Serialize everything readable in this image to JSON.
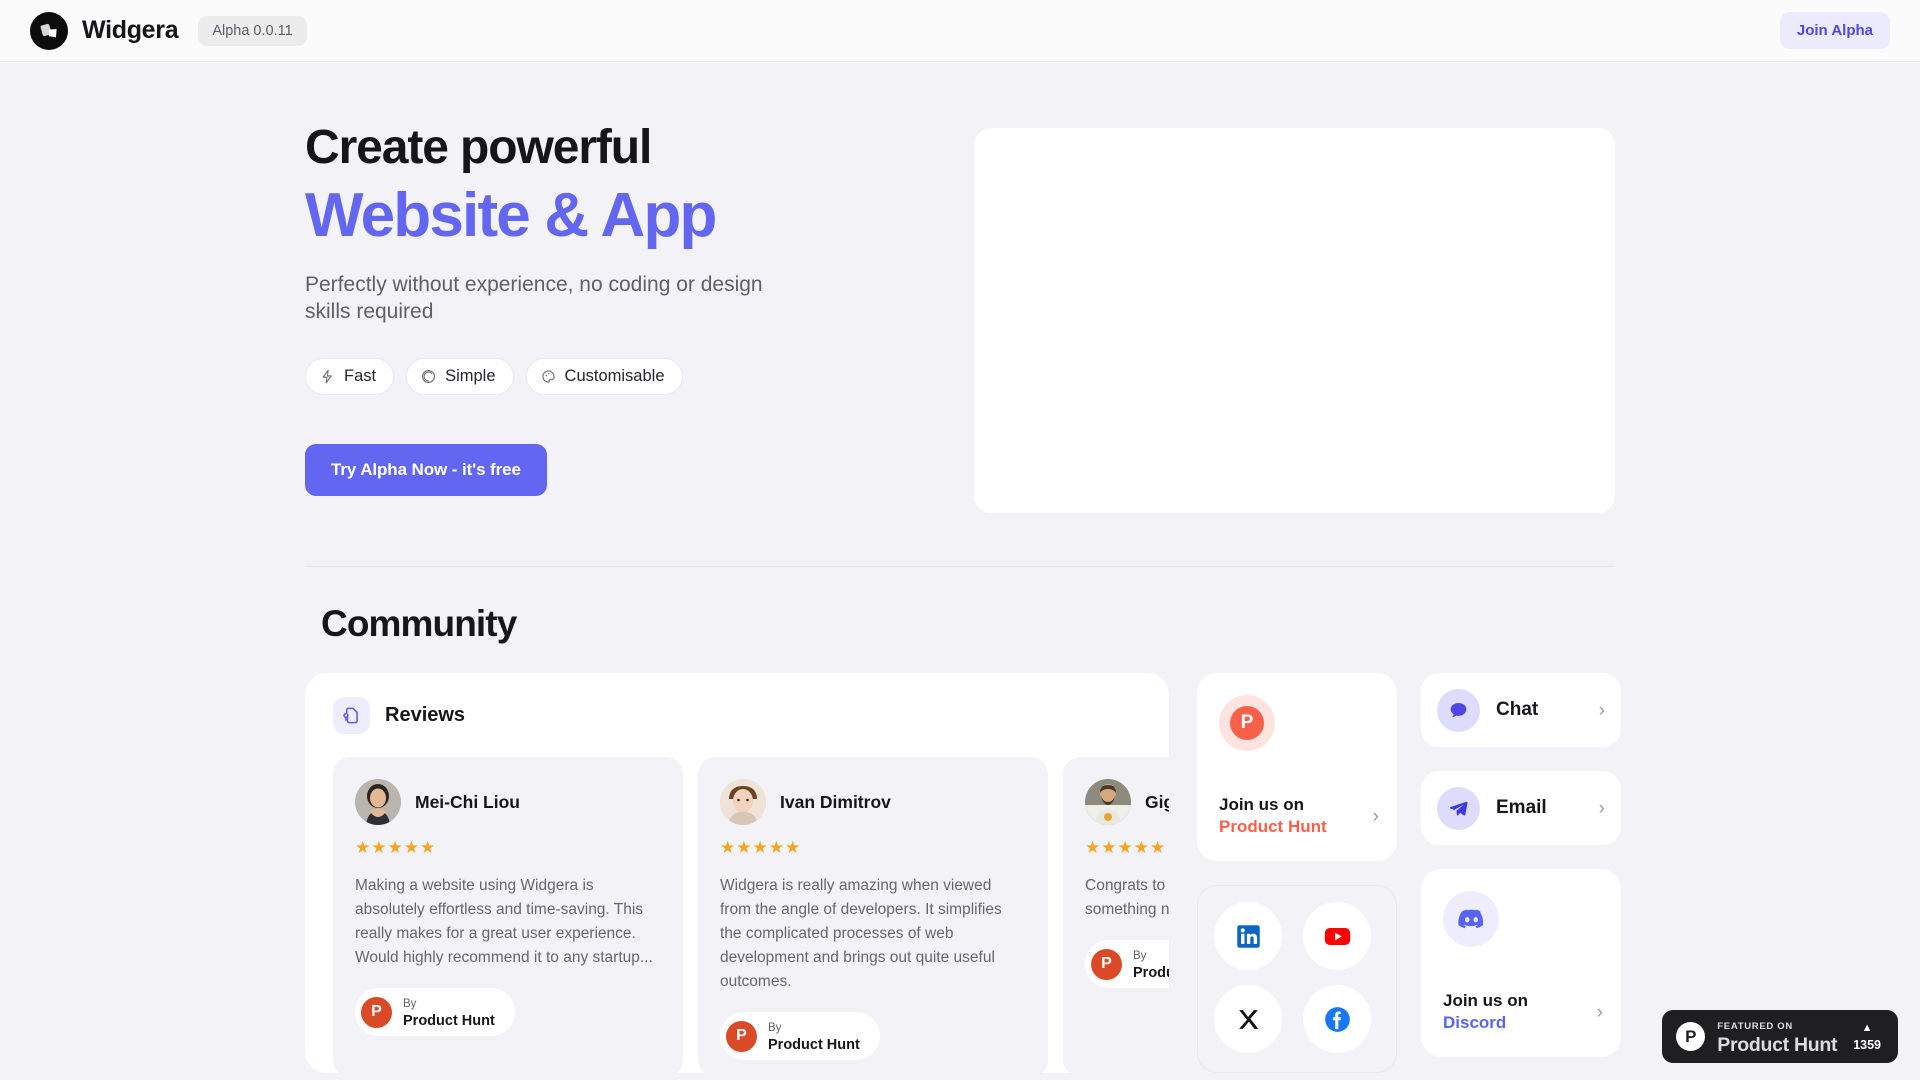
{
  "header": {
    "brand_name": "Widgera",
    "version_label": "Alpha 0.0.11",
    "join_alpha_label": "Join Alpha",
    "logo_icon": "widgera-logo-icon",
    "accent_color": "#6366f1"
  },
  "hero": {
    "title_line1": "Create powerful",
    "title_line2": "Website & App",
    "subtitle": "Perfectly without experience, no coding or design skills required",
    "pills": [
      {
        "label": "Fast",
        "icon": "lightning-bolt-icon"
      },
      {
        "label": "Simple",
        "icon": "target-circle-icon"
      },
      {
        "label": "Customisable",
        "icon": "palette-icon"
      }
    ],
    "cta_label": "Try Alpha Now - it's free"
  },
  "community": {
    "title": "Community",
    "reviews": {
      "panel_title": "Reviews",
      "panel_icon": "reviews-document-icon",
      "cards": [
        {
          "name": "Mei-Chi Liou",
          "stars": "★★★★★",
          "rating": 5,
          "text": "Making a website using Widgera is absolutely effortless and time-saving. This really makes for a great user experience. Would highly recommend it to any startup...",
          "badge_by": "By",
          "badge_source": "Product Hunt",
          "badge_initial": "P",
          "avatar": "avatar-woman-icon"
        },
        {
          "name": "Ivan Dimitrov",
          "stars": "★★★★★",
          "rating": 5,
          "text": "Widgera is really amazing when viewed from the angle of developers. It simplifies the complicated processes of web development and brings out quite useful outcomes.",
          "badge_by": "By",
          "badge_source": "Product Hunt",
          "badge_initial": "P",
          "avatar": "avatar-young-man-icon"
        },
        {
          "name": "Gig",
          "stars": "★★★★★",
          "rating": 5,
          "text": "Congrats to exciting laun super easy t something n",
          "badge_by": "By",
          "badge_source": "Produ",
          "badge_initial": "P",
          "avatar": "avatar-bearded-man-icon"
        }
      ]
    },
    "product_hunt_card": {
      "line1": "Join us on",
      "line2": "Product Hunt",
      "line2_color": "#f9604a",
      "icon": "product-hunt-icon",
      "icon_initial": "P",
      "chevron": "›"
    },
    "discord_card": {
      "line1": "Join us on",
      "line2": "Discord",
      "line2_color": "#5865f2",
      "icon": "discord-icon",
      "chevron": "›"
    },
    "link_cards": [
      {
        "label": "Chat",
        "icon": "chat-bubble-icon",
        "chevron": "›"
      },
      {
        "label": "Email",
        "icon": "paper-plane-icon",
        "chevron": "›"
      }
    ],
    "social_buttons": [
      {
        "name": "linkedin",
        "icon": "linkedin-icon"
      },
      {
        "name": "youtube",
        "icon": "youtube-icon"
      },
      {
        "name": "x-twitter",
        "icon": "x-twitter-icon"
      },
      {
        "name": "facebook",
        "icon": "facebook-icon"
      }
    ]
  },
  "product_hunt_badge": {
    "featured_on": "FEATURED ON",
    "product_name": "Product Hunt",
    "vote_caret": "▲",
    "vote_count": "1359",
    "mark_initial": "P"
  }
}
